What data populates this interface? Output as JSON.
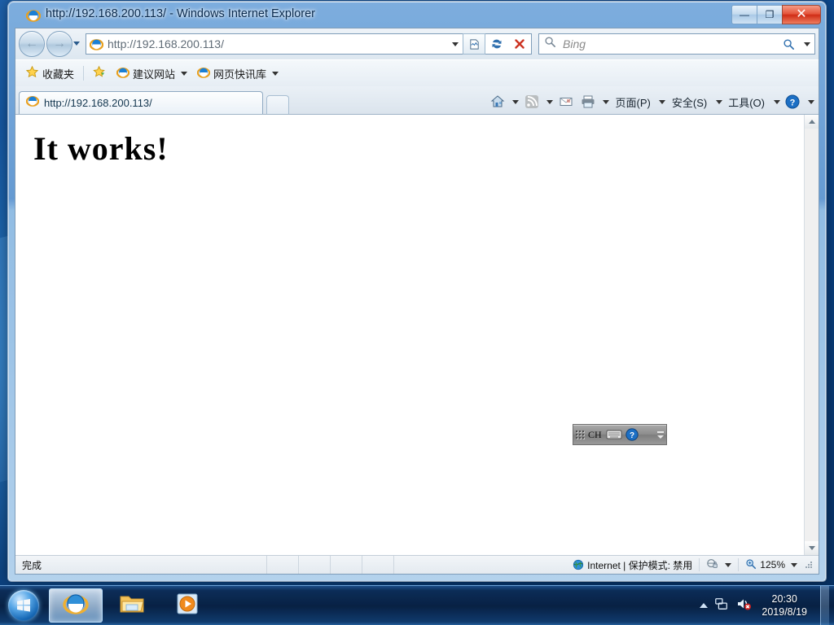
{
  "window": {
    "title": "http://192.168.200.113/ - Windows Internet Explorer",
    "icon": "ie-logo-icon",
    "minimize_label": "—",
    "maximize_label": "❐",
    "close_label": "✕"
  },
  "nav": {
    "back_label": "←",
    "forward_label": "→",
    "recent_pages_label": "",
    "address_value": "http://192.168.200.113/",
    "address_placeholder": "",
    "compat_view_name": "compatibility-view-icon",
    "refresh_name": "refresh-icon",
    "stop_name": "stop-icon",
    "stop_label": "✕"
  },
  "search": {
    "placeholder": "Bing",
    "value": "",
    "provider": "Bing",
    "go_label": ""
  },
  "favorites_bar": {
    "favorites_label": "收藏夹",
    "items": [
      {
        "label": "建议网站",
        "icon": "ie-logo-icon"
      },
      {
        "label": "网页快讯库",
        "icon": "ie-logo-icon"
      }
    ]
  },
  "tabs": {
    "active": {
      "title": "http://192.168.200.113/",
      "icon": "ie-logo-icon"
    },
    "new_tab_label": ""
  },
  "command_bar": {
    "home_name": "home-icon",
    "feeds_name": "rss-feed-icon",
    "mail_name": "mail-icon",
    "print_name": "print-icon",
    "menus": [
      {
        "label": "页面(P)"
      },
      {
        "label": "安全(S)"
      },
      {
        "label": "工具(O)"
      }
    ],
    "help_name": "help-icon"
  },
  "page": {
    "heading": "It works!",
    "background": "#ffffff"
  },
  "language_bar": {
    "input_language": "CH",
    "keyboard_name": "keyboard-icon",
    "help_name": "ime-help-icon",
    "minimize_label": "–",
    "options_label": "▾"
  },
  "status_bar": {
    "status_text": "完成",
    "zone_text": "Internet | 保护模式: 禁用",
    "zone_icon": "internet-zone-globe-icon",
    "privacy_icon": "privacy-report-icon",
    "zoom_level": "125%",
    "zoom_icon": "zoom-magnifier-icon"
  },
  "taskbar": {
    "start_name": "windows-start-orb",
    "buttons": [
      {
        "name": "taskbar-internet-explorer",
        "icon": "ie-logo-icon",
        "active": true
      },
      {
        "name": "taskbar-windows-explorer",
        "icon": "folder-icon",
        "active": false
      },
      {
        "name": "taskbar-media-player",
        "icon": "media-player-icon",
        "active": false
      }
    ],
    "tray": {
      "show_hidden_name": "show-hidden-icons-arrow",
      "network_name": "network-icon",
      "volume_name": "volume-muted-icon",
      "time": "20:30",
      "date": "2019/8/19"
    }
  },
  "colors": {
    "accent": "#1667b4",
    "close_button": "#cf2d16",
    "title_text": "#0a2a4d",
    "page_bg": "#ffffff"
  }
}
